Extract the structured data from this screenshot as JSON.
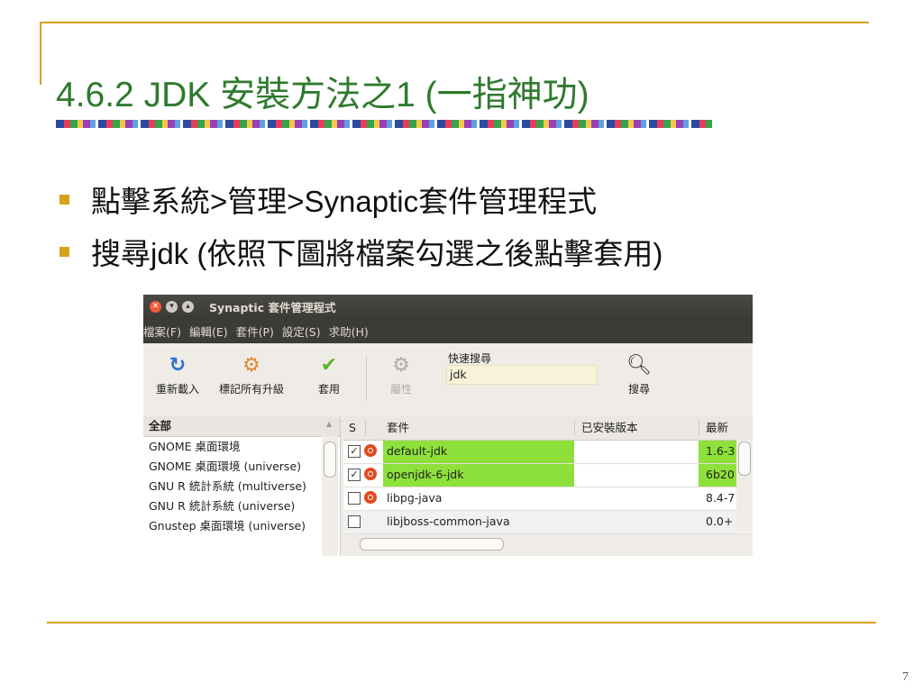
{
  "slide": {
    "title": "4.6.2 JDK 安裝方法之1 (一指神功)",
    "bullets": [
      "點擊系統>管理>Synaptic套件管理程式",
      "搜尋jdk (依照下圖將檔案勾選之後點擊套用)"
    ],
    "page_number": "7",
    "accent_color": "#d6a11c",
    "title_color": "#2e7a2e"
  },
  "window": {
    "title": "Synaptic 套件管理程式",
    "controls": [
      "close-icon",
      "minimize-icon",
      "maximize-icon"
    ],
    "menu": [
      "檔案(F)",
      "編輯(E)",
      "套件(P)",
      "設定(S)",
      "求助(H)"
    ],
    "toolbar": {
      "reload": "重新載入",
      "mark_all_upgrades": "標記所有升級",
      "apply": "套用",
      "properties": "屬性",
      "quick_search_label": "快速搜尋",
      "quick_search_value": "jdk",
      "search": "搜尋"
    },
    "left_panel": {
      "header": "全部",
      "items": [
        "GNOME 桌面環境",
        "GNOME 桌面環境 (universe)",
        "GNU R 統計系統 (multiverse)",
        "GNU R 統計系統 (universe)",
        "Gnustep 桌面環境 (universe)"
      ]
    },
    "package_table": {
      "columns": [
        "S",
        "套件",
        "已安裝版本",
        "最新"
      ],
      "rows": [
        {
          "checked": true,
          "name": "default-jdk",
          "installed": "",
          "latest": "1.6-3",
          "highlight": true
        },
        {
          "checked": true,
          "name": "openjdk-6-jdk",
          "installed": "",
          "latest": "6b20",
          "highlight": true
        },
        {
          "checked": false,
          "name": "libpg-java",
          "installed": "",
          "latest": "8.4-7",
          "highlight": false
        },
        {
          "checked": false,
          "name": "libjboss-common-java",
          "installed": "",
          "latest": "0.0+",
          "highlight": false
        }
      ],
      "highlight_color": "#8ee03a"
    }
  }
}
